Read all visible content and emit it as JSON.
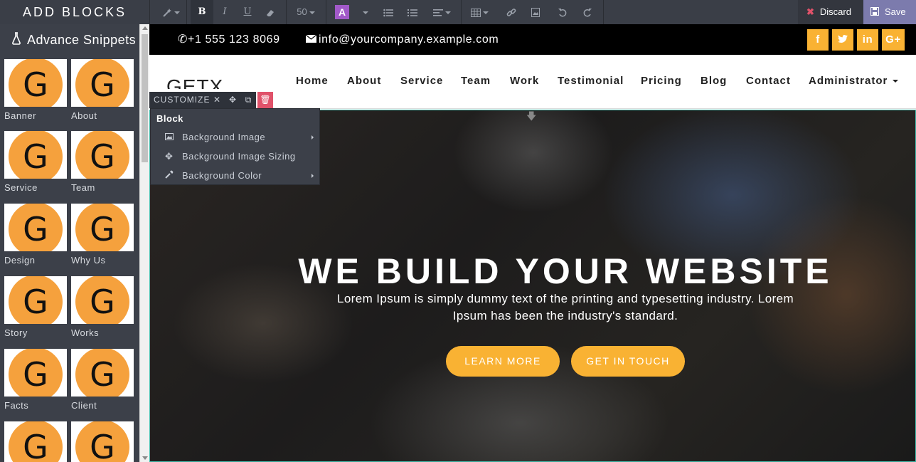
{
  "toolbar": {
    "add_blocks_label": "ADD BLOCKS",
    "font_size_value": "50",
    "text_color_letter": "A",
    "discard_label": "Discard",
    "save_label": "Save"
  },
  "panel": {
    "title": "Advance Snippets",
    "thumb_letter": "G",
    "snippets": [
      "Banner",
      "About",
      "Service",
      "Team",
      "Design",
      "Why Us",
      "Story",
      "Works",
      "Facts",
      "Client",
      "",
      ""
    ]
  },
  "customize": {
    "label": "CUSTOMIZE",
    "menu_header": "Block",
    "items": [
      "Background Image",
      "Background Image Sizing",
      "Background Color"
    ]
  },
  "site": {
    "phone": "+1 555 123 8069",
    "email": "info@yourcompany.example.com",
    "social": [
      "f",
      "t",
      "in",
      "G+"
    ],
    "logo": "GETX",
    "nav": [
      "Home",
      "About",
      "Service",
      "Team",
      "Work",
      "Testimonial",
      "Pricing",
      "Blog",
      "Contact",
      "Administrator"
    ],
    "hero_title": "WE BUILD YOUR WEBSITE",
    "hero_text": "Lorem Ipsum is simply dummy text of the printing and typesetting industry. Lorem Ipsum has been the industry's standard.",
    "btn_learn": "LEARN MORE",
    "btn_touch": "GET IN TOUCH"
  },
  "colors": {
    "accent": "#f9b233",
    "save_bg": "#7c7bad",
    "delete": "#e0526a",
    "snippet_circle": "#f5a13d"
  }
}
